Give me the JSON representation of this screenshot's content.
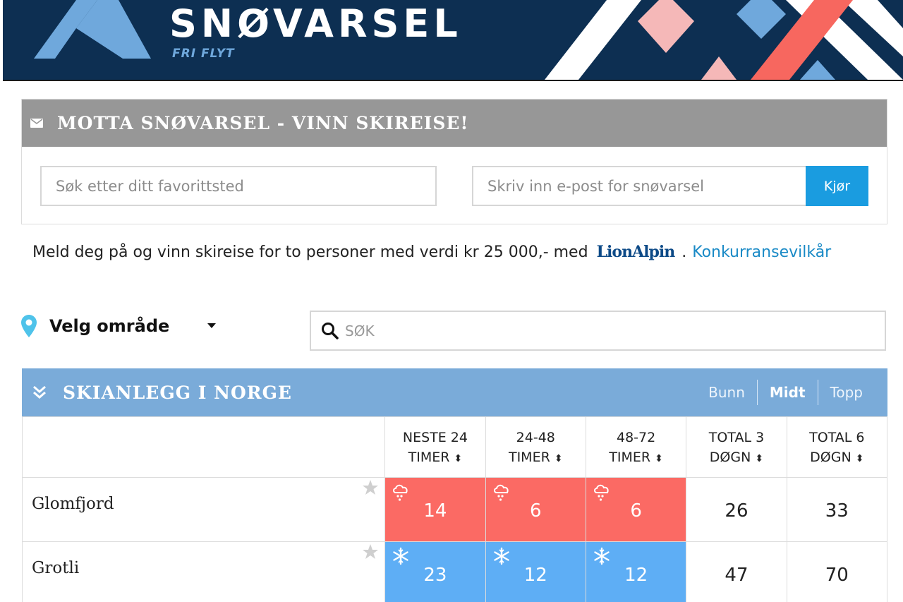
{
  "header": {
    "title": "SNØVARSEL",
    "subtitle": "FRI FLYT"
  },
  "newsletter": {
    "title": "MOTTA SNØVARSEL - VINN SKIREISE!",
    "search_placeholder": "Søk etter ditt favorittsted",
    "email_placeholder": "Skriv inn e-post for snøvarsel",
    "submit_label": "Kjør"
  },
  "promo": {
    "text": "Meld deg på og vinn skireise for to personer med verdi kr 25 000,- med",
    "sponsor_logo": "LionAlpin",
    "separator": ".",
    "terms_link": "Konkurransevilkår"
  },
  "filters": {
    "region_label": "Velg område",
    "search_placeholder": "SØK"
  },
  "ski_table": {
    "title": "SKIANLEGG I NORGE",
    "elevation_toggles": [
      {
        "label": "Bunn",
        "active": false
      },
      {
        "label": "Midt",
        "active": true
      },
      {
        "label": "Topp",
        "active": false
      }
    ],
    "columns": [
      {
        "line1": "NESTE 24",
        "line2": "TIMER"
      },
      {
        "line1": "24-48",
        "line2": "TIMER"
      },
      {
        "line1": "48-72",
        "line2": "TIMER"
      },
      {
        "line1": "TOTAL 3",
        "line2": "DØGN"
      },
      {
        "line1": "TOTAL 6",
        "line2": "DØGN"
      }
    ],
    "sort_icon": "sort-arrows-icon",
    "rows": [
      {
        "name": "Glomfjord",
        "forecast": [
          "14",
          "6",
          "6"
        ],
        "forecast_type": "sleet-cloud-icon",
        "forecast_color": "#fb6a64",
        "total3": "26",
        "total6": "33"
      },
      {
        "name": "Grotli",
        "forecast": [
          "23",
          "12",
          "12"
        ],
        "forecast_type": "snowflake-icon",
        "forecast_color": "#5eaef5",
        "total3": "47",
        "total6": "70"
      }
    ]
  },
  "colors": {
    "header_bg": "#0d2f52",
    "panel_head": "#979797",
    "accent_button": "#1a9ce0",
    "ski_head": "#7aabd9",
    "warm_cell": "#fb6a64",
    "cold_cell": "#5eaef5",
    "link": "#1a8ac6"
  }
}
